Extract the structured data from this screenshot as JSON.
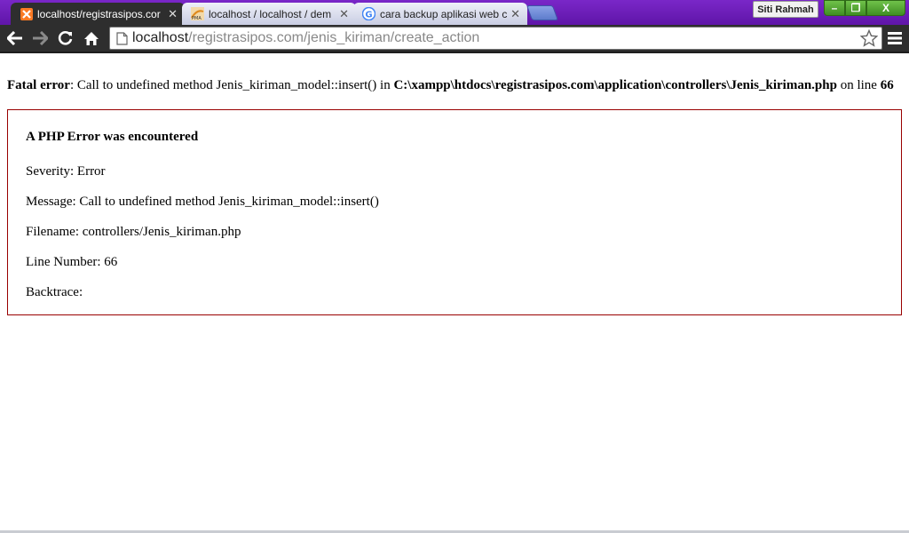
{
  "tabs": [
    {
      "title": "localhost/registrasipos.cor",
      "favicon": "xampp-icon",
      "active": true
    },
    {
      "title": "localhost / localhost / dem",
      "favicon": "phpmyadmin-icon",
      "active": false
    },
    {
      "title": "cara backup aplikasi web c",
      "favicon": "google-icon",
      "active": false
    }
  ],
  "window": {
    "user": "Siti Rahmah",
    "minimize": "–",
    "maximize": "❐",
    "close": "X"
  },
  "toolbar": {
    "url_host": "localhost",
    "url_path": "/registrasipos.com/jenis_kiriman/create_action"
  },
  "page": {
    "fatal_label": "Fatal error",
    "fatal_message": ": Call to undefined method Jenis_kiriman_model::insert() in ",
    "fatal_path": "C:\\xampp\\htdocs\\registrasipos.com\\application\\controllers\\Jenis_kiriman.php",
    "fatal_online": " on line ",
    "fatal_line": "66",
    "error_box": {
      "heading": "A PHP Error was encountered",
      "severity": "Severity: Error",
      "message": "Message: Call to undefined method Jenis_kiriman_model::insert()",
      "filename": "Filename: controllers/Jenis_kiriman.php",
      "line_number": "Line Number: 66",
      "backtrace": "Backtrace:"
    }
  },
  "colors": {
    "titlebar": "#6a1fb8",
    "toolbar": "#2e2e2e",
    "error_border": "#990000",
    "window_buttons": "#4f9e2e"
  }
}
